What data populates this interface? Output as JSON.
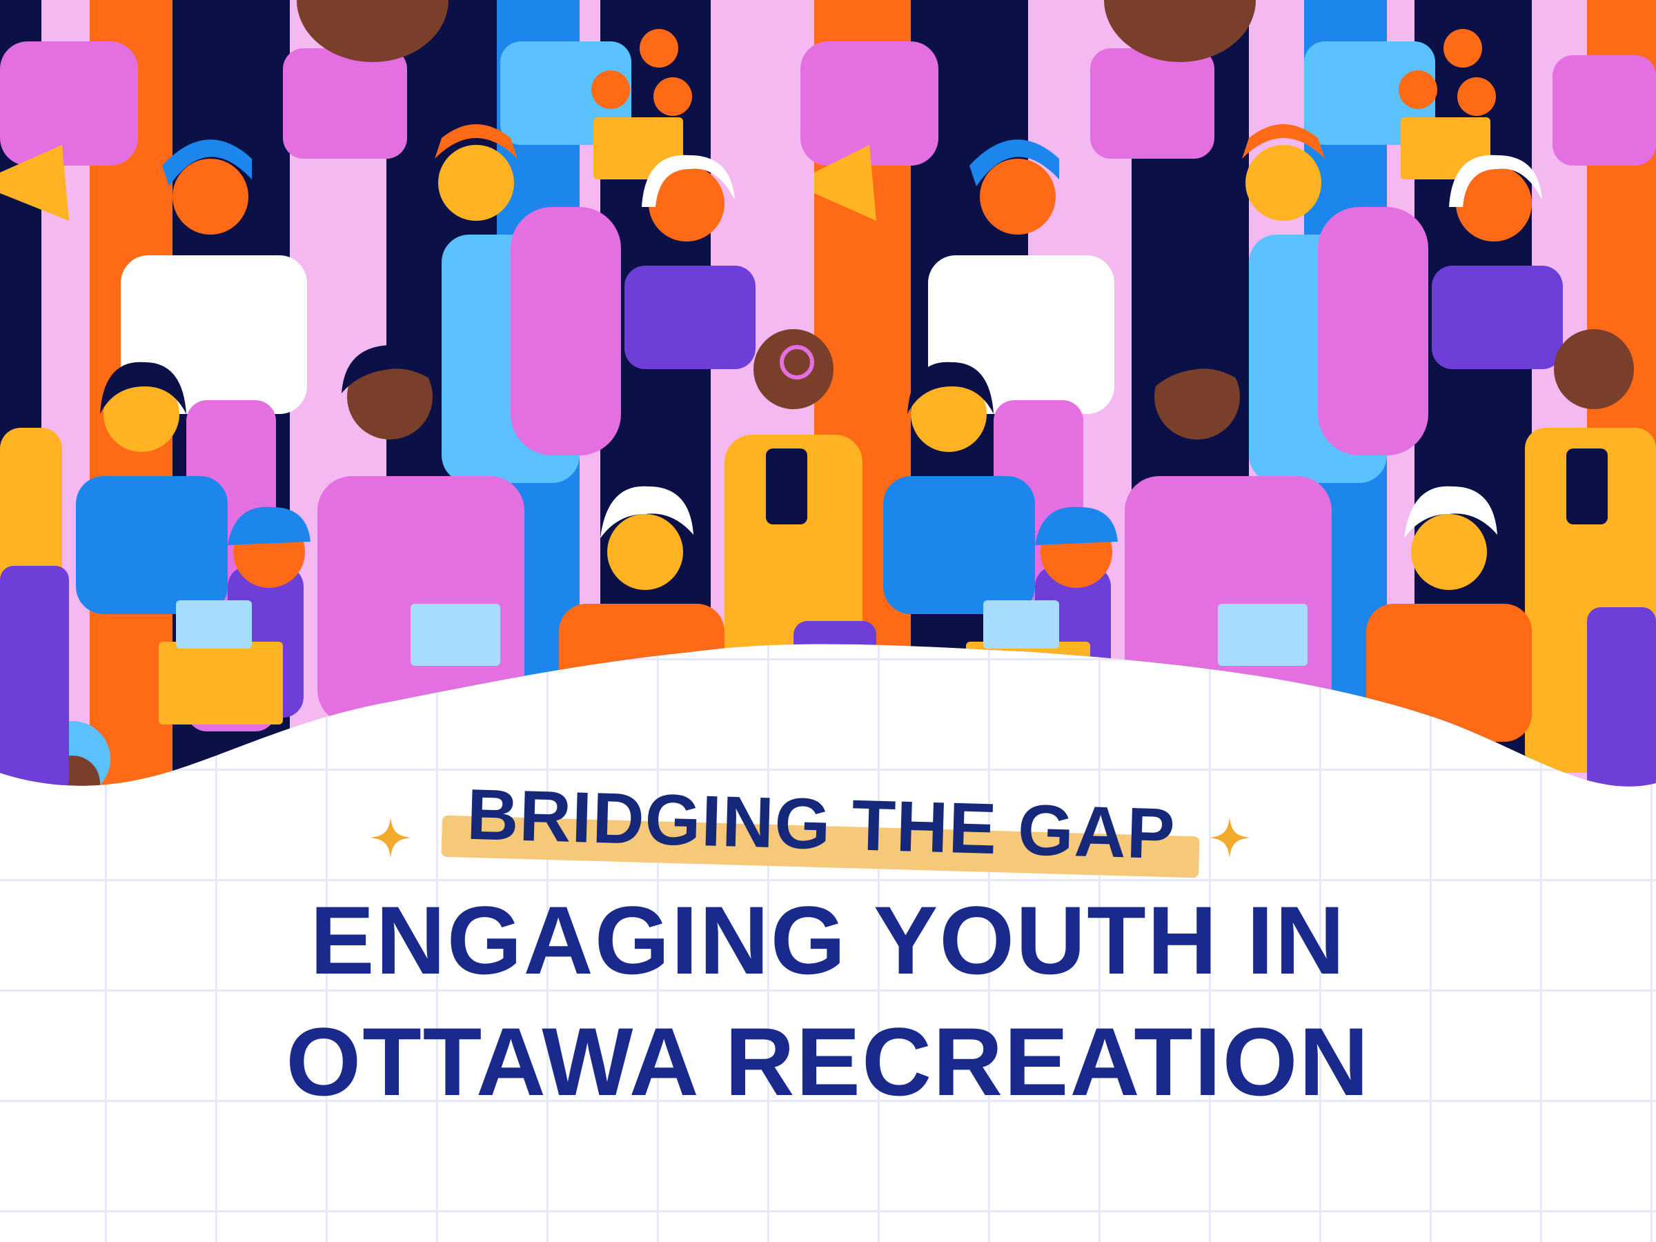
{
  "subtitle": "BRIDGING THE GAP",
  "title_lines": [
    "ENGAGING YOUTH IN",
    "OTTAWA RECREATION"
  ],
  "colors": {
    "title_navy": "#1a2a8c",
    "highlight_yellow": "#f6c87a",
    "sparkle_gold": "#f3a92b",
    "grid_line": "#e7e9f7",
    "illustration_palette": [
      "#0b1147",
      "#e46fe0",
      "#ff6a17",
      "#1c86ec",
      "#6d3ed8",
      "#ffb322",
      "#7a3f2a",
      "#ffffff",
      "#5cc1ff"
    ]
  },
  "icons": [
    "sparkle-icon"
  ]
}
